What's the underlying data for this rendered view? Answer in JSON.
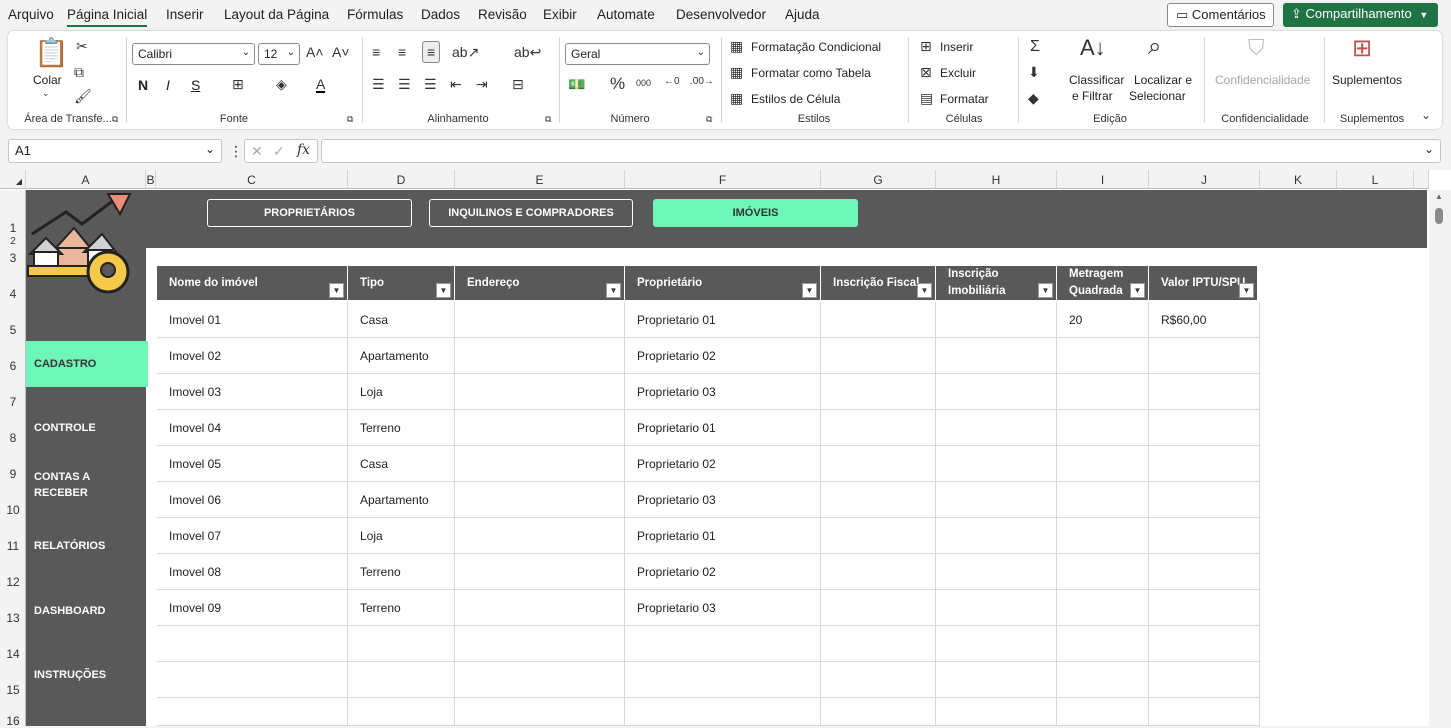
{
  "menu": {
    "items": [
      "Arquivo",
      "Página Inicial",
      "Inserir",
      "Layout da Página",
      "Fórmulas",
      "Dados",
      "Revisão",
      "Exibir",
      "Automate",
      "Desenvolvedor",
      "Ajuda"
    ],
    "active": "Página Inicial",
    "comments_label": "Comentários",
    "share_label": "Compartilhamento"
  },
  "ribbon": {
    "clipboard": {
      "paste": "Colar",
      "group": "Área de Transfe..."
    },
    "font": {
      "name": "Calibri",
      "size": "12",
      "bold": "N",
      "italic": "I",
      "underline": "S",
      "group": "Fonte"
    },
    "alignment": {
      "group": "Alinhamento"
    },
    "number": {
      "format": "Geral",
      "group": "Número"
    },
    "styles": {
      "conditional": "Formatação Condicional",
      "table": "Formatar como Tabela",
      "cell": "Estilos de Célula",
      "group": "Estilos"
    },
    "cells": {
      "insert": "Inserir",
      "delete": "Excluir",
      "format": "Formatar",
      "group": "Células"
    },
    "editing": {
      "sort1": "Classificar",
      "sort2": "e Filtrar",
      "find1": "Localizar e",
      "find2": "Selecionar",
      "group": "Edição"
    },
    "sensitivity": {
      "label": "Confidencialidade",
      "group": "Confidencialidade"
    },
    "addins": {
      "label": "Suplementos",
      "group": "Suplementos"
    }
  },
  "formula": {
    "cell_ref": "A1",
    "content": ""
  },
  "columns": [
    "A",
    "B",
    "C",
    "D",
    "E",
    "F",
    "G",
    "H",
    "I",
    "J",
    "K",
    "L"
  ],
  "rows": [
    "1",
    "2",
    "3",
    "4",
    "5",
    "6",
    "7",
    "8",
    "9",
    "10",
    "11",
    "12",
    "13",
    "14",
    "15",
    "16"
  ],
  "nav_buttons": [
    "PROPRIETÁRIOS",
    "INQUILINOS E COMPRADORES",
    "IMÓVEIS"
  ],
  "sidebar": [
    "CADASTRO",
    "CONTROLE",
    "CONTAS A RECEBER",
    "RELATÓRIOS",
    "DASHBOARD",
    "INSTRUÇÕES"
  ],
  "table": {
    "headers": [
      "Nome do imóvel",
      "Tipo",
      "Endereço",
      "Proprietário",
      "Inscrição Fiscal",
      "Inscrição Imobiliária",
      "Metragem Quadrada",
      "Valor IPTU/SPU"
    ],
    "rows": [
      [
        "Imovel 01",
        "Casa",
        "",
        "Proprietario 01",
        "",
        "",
        "20",
        "R$60,00"
      ],
      [
        "Imovel 02",
        "Apartamento",
        "",
        "Proprietario 02",
        "",
        "",
        "",
        ""
      ],
      [
        "Imovel 03",
        "Loja",
        "",
        "Proprietario 03",
        "",
        "",
        "",
        ""
      ],
      [
        "Imovel 04",
        "Terreno",
        "",
        "Proprietario 01",
        "",
        "",
        "",
        ""
      ],
      [
        "Imovel 05",
        "Casa",
        "",
        "Proprietario 02",
        "",
        "",
        "",
        ""
      ],
      [
        "Imovel 06",
        "Apartamento",
        "",
        "Proprietario 03",
        "",
        "",
        "",
        ""
      ],
      [
        "Imovel 07",
        "Loja",
        "",
        "Proprietario 01",
        "",
        "",
        "",
        ""
      ],
      [
        "Imovel 08",
        "Terreno",
        "",
        "Proprietario 02",
        "",
        "",
        "",
        ""
      ],
      [
        "Imovel 09",
        "Terreno",
        "",
        "Proprietario 03",
        "",
        "",
        "",
        ""
      ],
      [
        "",
        "",
        "",
        "",
        "",
        "",
        "",
        ""
      ],
      [
        "",
        "",
        "",
        "",
        "",
        "",
        "",
        ""
      ],
      [
        "",
        "",
        "",
        "",
        "",
        "",
        "",
        ""
      ]
    ]
  },
  "colors": {
    "accent": "#6ef7b9",
    "panel": "#595959",
    "excel_green": "#217346"
  }
}
